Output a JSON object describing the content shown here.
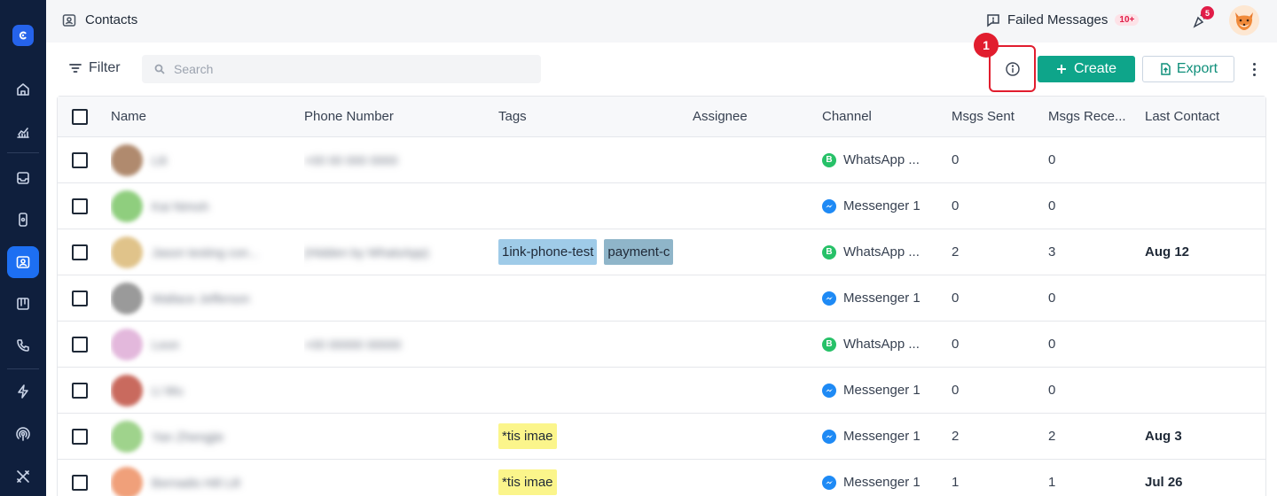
{
  "topbar": {
    "title": "Contacts",
    "failed_messages_label": "Failed Messages",
    "failed_messages_badge": "10+",
    "notifications_count": "5"
  },
  "toolbar": {
    "filter_label": "Filter",
    "search_placeholder": "Search",
    "step_badge": "1",
    "create_label": "Create",
    "export_label": "Export"
  },
  "table": {
    "columns": [
      "Name",
      "Phone Number",
      "Tags",
      "Assignee",
      "Channel",
      "Msgs Sent",
      "Msgs Rece...",
      "Last Contact"
    ],
    "rows": [
      {
        "name": "Lili",
        "phone": "+00 00 000 0000",
        "tags": [],
        "channel": "WhatsApp ...",
        "channel_type": "whatsapp",
        "sent": "0",
        "received": "0",
        "last": "",
        "avatar_color": "#b08a6e"
      },
      {
        "name": "Kai Nimoh",
        "phone": "",
        "tags": [],
        "channel": "Messenger 1",
        "channel_type": "messenger",
        "sent": "0",
        "received": "0",
        "last": "",
        "avatar_color": "#8fce7e"
      },
      {
        "name": "Jason testing con...",
        "phone": "(Hidden by WhatsApp)",
        "tags": [
          {
            "label": "1ink-phone-test",
            "color": "blue"
          },
          {
            "label": "payment-c",
            "color": "slate"
          }
        ],
        "channel": "WhatsApp ...",
        "channel_type": "whatsapp",
        "sent": "2",
        "received": "3",
        "last": "Aug 12",
        "avatar_color": "#e0c38a"
      },
      {
        "name": "Wallace Jefferson",
        "phone": "",
        "tags": [],
        "channel": "Messenger 1",
        "channel_type": "messenger",
        "sent": "0",
        "received": "0",
        "last": "",
        "avatar_color": "#9a9a9a"
      },
      {
        "name": "Leon",
        "phone": "+00 00000 00000",
        "tags": [],
        "channel": "WhatsApp ...",
        "channel_type": "whatsapp",
        "sent": "0",
        "received": "0",
        "last": "",
        "avatar_color": "#e3b8dc"
      },
      {
        "name": "Li Wu",
        "phone": "",
        "tags": [],
        "channel": "Messenger 1",
        "channel_type": "messenger",
        "sent": "0",
        "received": "0",
        "last": "",
        "avatar_color": "#c96a5e"
      },
      {
        "name": "Yan Zhengjie",
        "phone": "",
        "tags": [
          {
            "label": "*tis imae",
            "color": "yellow"
          }
        ],
        "channel": "Messenger 1",
        "channel_type": "messenger",
        "sent": "2",
        "received": "2",
        "last": "Aug 3",
        "avatar_color": "#9fd38c"
      },
      {
        "name": "Bernadis Hill Lill",
        "phone": "",
        "tags": [
          {
            "label": "*tis imae",
            "color": "yellow"
          }
        ],
        "channel": "Messenger 1",
        "channel_type": "messenger",
        "sent": "1",
        "received": "1",
        "last": "Jul 26",
        "avatar_color": "#f0a07a"
      }
    ]
  },
  "colors": {
    "sidebar": "#0f1f3d",
    "accent": "#0ea58a",
    "active_nav": "#1d6ff2",
    "highlight": "#e11d2e"
  },
  "icons": {
    "sidebar": [
      "home-icon",
      "analytics-icon",
      "inbox-icon",
      "device-icon",
      "contacts-icon",
      "board-icon",
      "phone-icon",
      "lightning-icon",
      "broadcast-icon",
      "tools-icon"
    ]
  }
}
